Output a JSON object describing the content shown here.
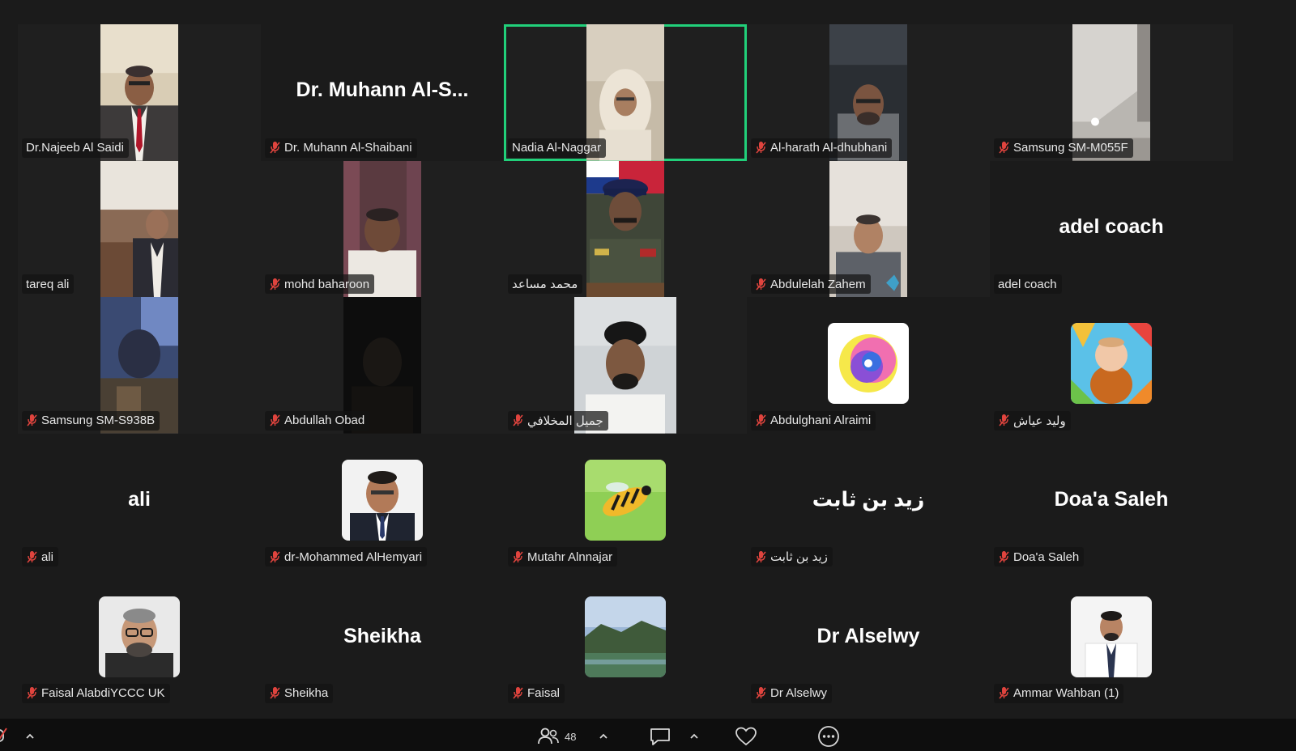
{
  "meeting": {
    "participant_count": "48",
    "active_speaker": "Nadia Al-Naggar"
  },
  "tiles": [
    {
      "name": "Dr.Najeeb Al Saidi",
      "muted": false,
      "kind": "video"
    },
    {
      "name": "Dr. Muhann Al-Shaibani",
      "display": "Dr. Muhann Al-S...",
      "muted": true,
      "kind": "text"
    },
    {
      "name": "Nadia Al-Naggar",
      "muted": false,
      "kind": "video",
      "active": true
    },
    {
      "name": "Al-harath Al-dhubhani",
      "muted": true,
      "kind": "video"
    },
    {
      "name": "Samsung SM-M055F",
      "muted": true,
      "kind": "video"
    },
    {
      "name": "tareq ali",
      "muted": false,
      "kind": "video"
    },
    {
      "name": "mohd baharoon",
      "muted": true,
      "kind": "video"
    },
    {
      "name": "محمد مساعد",
      "muted": false,
      "kind": "video"
    },
    {
      "name": "Abdulelah Zahem",
      "muted": true,
      "kind": "video"
    },
    {
      "name": "adel coach",
      "display": "adel coach",
      "muted": false,
      "kind": "text"
    },
    {
      "name": "Samsung SM-S938B",
      "muted": true,
      "kind": "video"
    },
    {
      "name": "Abdullah Obad",
      "muted": true,
      "kind": "video"
    },
    {
      "name": "جميل المخلافي",
      "muted": true,
      "kind": "video"
    },
    {
      "name": "Abdulghani Alraimi",
      "muted": true,
      "kind": "avatar"
    },
    {
      "name": "وليد عياش",
      "muted": true,
      "kind": "avatar"
    },
    {
      "name": "ali",
      "display": "ali",
      "muted": true,
      "kind": "text"
    },
    {
      "name": "dr-Mohammed AlHemyari",
      "muted": true,
      "kind": "avatar"
    },
    {
      "name": "Mutahr Alnnajar",
      "muted": true,
      "kind": "avatar"
    },
    {
      "name": "زيد بن ثابت",
      "display": "زيد بن ثابت",
      "muted": true,
      "kind": "text"
    },
    {
      "name": "Doa'a Saleh",
      "display": "Doa'a Saleh",
      "muted": true,
      "kind": "text"
    },
    {
      "name": "Faisal AlabdiYCCC UK",
      "muted": true,
      "kind": "avatar"
    },
    {
      "name": "Sheikha",
      "display": "Sheikha",
      "muted": true,
      "kind": "text"
    },
    {
      "name": "Faisal",
      "muted": true,
      "kind": "avatar"
    },
    {
      "name": "Dr Alselwy",
      "display": "Dr Alselwy",
      "muted": true,
      "kind": "text"
    },
    {
      "name": "Ammar Wahban (1)",
      "muted": true,
      "kind": "avatar"
    }
  ],
  "toolbar": {
    "buttons": [
      "mute-icon",
      "participants-icon",
      "chat-icon",
      "reactions-icon",
      "more-icon"
    ]
  },
  "colors": {
    "active_border": "#21d07a",
    "muted_icon": "#e0443e",
    "background": "#1b1b1b"
  }
}
